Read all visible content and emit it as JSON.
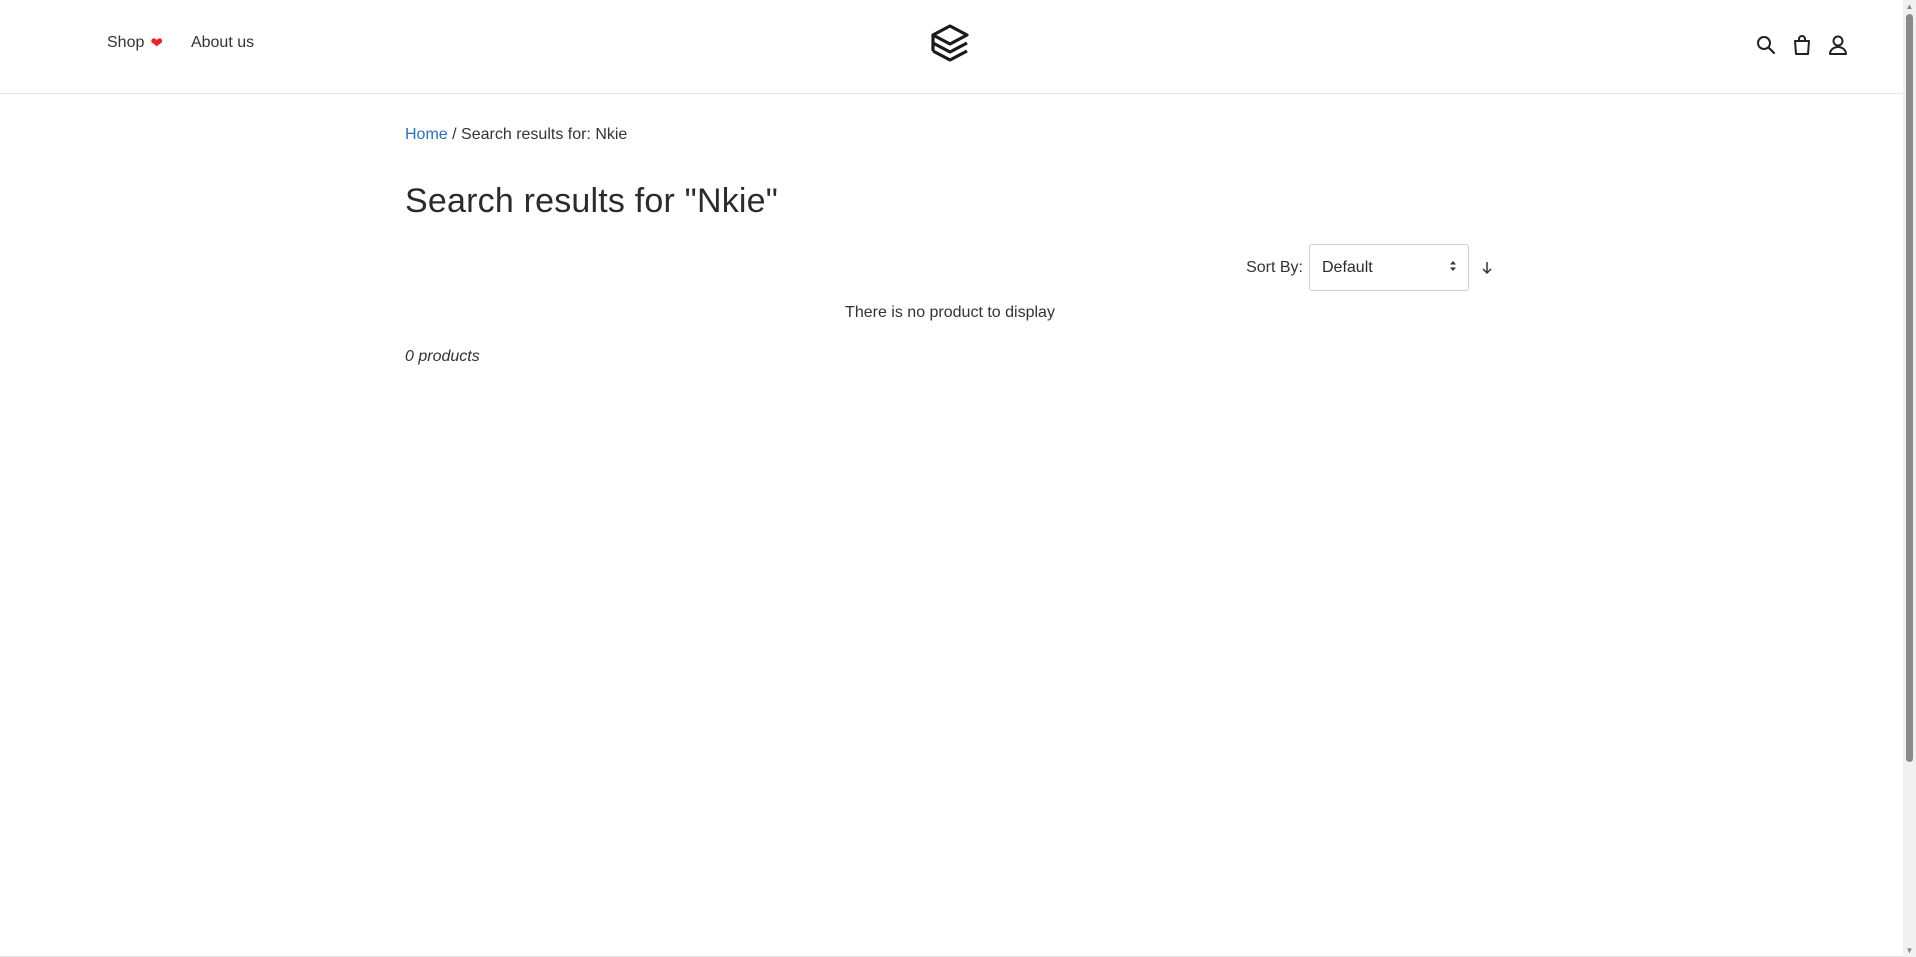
{
  "header": {
    "nav": [
      {
        "label": "Shop",
        "icon": "heart-icon"
      },
      {
        "label": "About us"
      }
    ],
    "logo": "logo-icon",
    "actions": [
      "search-icon",
      "cart-icon",
      "account-icon"
    ]
  },
  "breadcrumb": {
    "home_label": "Home",
    "separator": "/",
    "current": "Search results for: Nkie"
  },
  "page_title": "Search results for \"Nkie\"",
  "sort": {
    "label": "Sort By:",
    "selected": "Default",
    "direction_icon": "arrow-down-icon"
  },
  "empty_message": "There is no product to display",
  "product_count": "0 products",
  "colors": {
    "link": "#2a6ebb",
    "heart": "#e8242c",
    "text": "#2b2b2b"
  }
}
